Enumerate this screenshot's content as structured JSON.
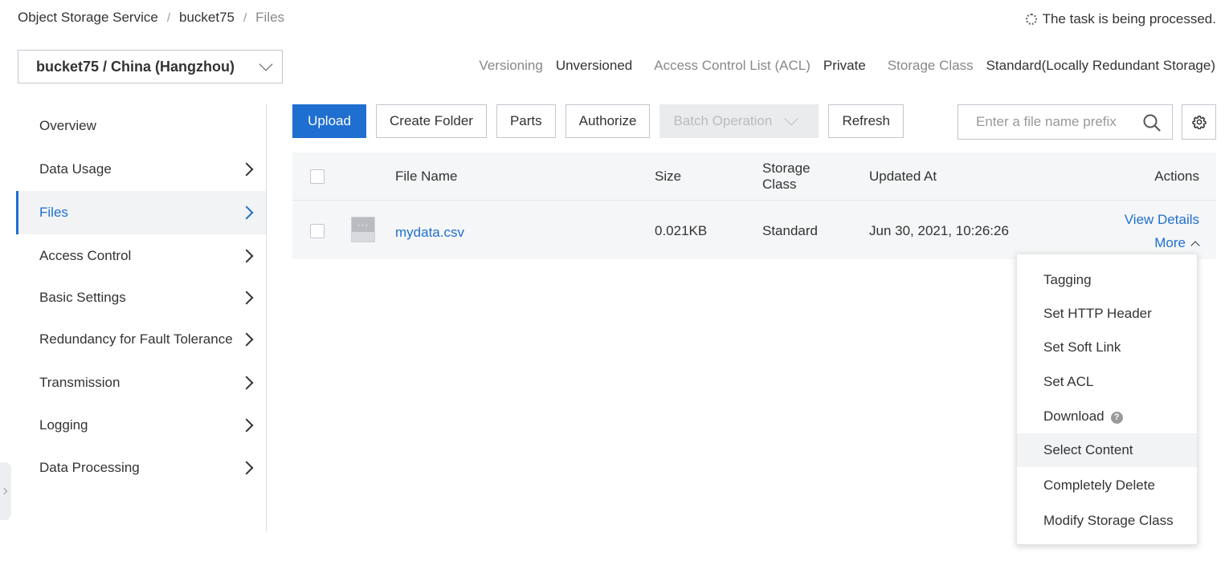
{
  "breadcrumb": {
    "items": [
      "Object Storage Service",
      "bucket75",
      "Files"
    ],
    "separator": "/"
  },
  "task_status": "The task is being processed.",
  "bucket_selector": {
    "label": "bucket75 / China (Hangzhou)"
  },
  "meta": {
    "versioning_label": "Versioning",
    "versioning_value": "Unversioned",
    "acl_label": "Access Control List (ACL)",
    "acl_value": "Private",
    "storage_class_label": "Storage Class",
    "storage_class_value": "Standard(Locally Redundant Storage)"
  },
  "sidebar": {
    "items": [
      {
        "label": "Overview",
        "has_arrow": false
      },
      {
        "label": "Data Usage",
        "has_arrow": true
      },
      {
        "label": "Files",
        "has_arrow": true,
        "active": true
      },
      {
        "label": "Access Control",
        "has_arrow": true
      },
      {
        "label": "Basic Settings",
        "has_arrow": true
      },
      {
        "label": "Redundancy for Fault Tolerance",
        "has_arrow": true
      },
      {
        "label": "Transmission",
        "has_arrow": true
      },
      {
        "label": "Logging",
        "has_arrow": true
      },
      {
        "label": "Data Processing",
        "has_arrow": true
      }
    ]
  },
  "toolbar": {
    "upload": "Upload",
    "create_folder": "Create Folder",
    "parts": "Parts",
    "authorize": "Authorize",
    "batch_operation": "Batch Operation",
    "refresh": "Refresh"
  },
  "search": {
    "placeholder": "Enter a file name prefix"
  },
  "table": {
    "headers": {
      "file_name": "File Name",
      "size": "Size",
      "storage_class_line1": "Storage",
      "storage_class_line2": "Class",
      "updated_at": "Updated At",
      "actions": "Actions"
    },
    "rows": [
      {
        "file_name": "mydata.csv",
        "size": "0.021KB",
        "storage_class": "Standard",
        "updated_at": "Jun 30, 2021, 10:26:26",
        "view_details": "View Details",
        "more": "More"
      }
    ]
  },
  "more_menu": {
    "items": [
      "Tagging",
      "Set HTTP Header",
      "Set Soft Link",
      "Set ACL",
      "Download",
      "Select Content",
      "Completely Delete",
      "Modify Storage Class"
    ],
    "hovered": "Select Content"
  },
  "colors": {
    "primary": "#1f6fd1",
    "text": "#333333",
    "muted": "#888888",
    "table_bg": "#f5f6f7",
    "border": "#c4c6cf"
  }
}
